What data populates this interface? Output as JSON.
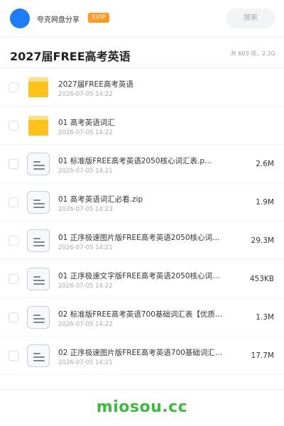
{
  "header": {
    "user_name": "夸克网盘分享",
    "badge": "SVIP",
    "search_label": "搜索",
    "avatar_color": "#1f7cf7",
    "badge_color": "#ff9a1f"
  },
  "folder": {
    "title": "2027届FREE高考英语",
    "summary": "共 603 项，2.2G"
  },
  "files": [
    {
      "type": "folder",
      "icon": "folder-icon",
      "name": "2027届FREE高考英语",
      "date": "2026-07-05 14:22",
      "size": ""
    },
    {
      "type": "folder",
      "icon": "folder-icon",
      "name": "01 高考英语词汇",
      "date": "2026-07-05 14:22",
      "size": ""
    },
    {
      "type": "file",
      "icon": "document-icon",
      "name": "01 标准版FREE高考英语2050核心词汇表.p…",
      "date": "2026-07-05 14:21",
      "size": "2.6M"
    },
    {
      "type": "file",
      "icon": "document-icon",
      "name": "01 高考英语词汇必看.zip",
      "date": "2026-07-05 14:23",
      "size": "1.9M"
    },
    {
      "type": "file",
      "icon": "document-icon",
      "name": "01 正序极速图片版FREE高考英语2050核心词…",
      "date": "2026-07-05 14:21",
      "size": "29.3M"
    },
    {
      "type": "file",
      "icon": "document-icon",
      "name": "01 正序极速文字版FREE高考英语2050核心词…",
      "date": "2026-07-05 14:22",
      "size": "453KB"
    },
    {
      "type": "file",
      "icon": "document-icon",
      "name": "02 标准版FREE高考英语700基础词汇表【优质…",
      "date": "2026-07-05 14:22",
      "size": "1.3M"
    },
    {
      "type": "file",
      "icon": "document-icon",
      "name": "02 正序极速图片版FREE高考英语700基础词汇…",
      "date": "2026-07-05 14:21",
      "size": "17.7M"
    }
  ],
  "footer": {
    "watermark": "miosou.cc",
    "watermark_color": "#3bbd3b"
  }
}
